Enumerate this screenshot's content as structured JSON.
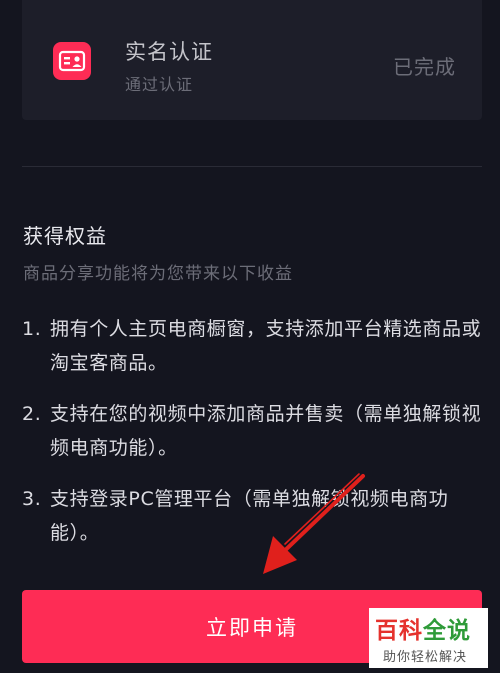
{
  "verification": {
    "title": "实名认证",
    "subtitle": "通过认证",
    "status": "已完成",
    "icon": "id-card-icon",
    "accent_color": "#fe2c55"
  },
  "benefits": {
    "title": "获得权益",
    "subtitle": "商品分享功能将为您带来以下收益",
    "items": [
      {
        "number": "1.",
        "text": "拥有个人主页电商橱窗，支持添加平台精选商品或淘宝客商品。"
      },
      {
        "number": "2.",
        "text": "支持在您的视频中添加商品并售卖（需单独解锁视频电商功能）。"
      },
      {
        "number": "3.",
        "text": "支持登录PC管理平台（需单独解锁视频电商功能）。"
      }
    ]
  },
  "apply_button": {
    "label": "立即申请",
    "color": "#fe2c55"
  },
  "annotation": {
    "icon": "arrow-annotation-icon",
    "color": "#e0201c"
  },
  "watermark": {
    "main_red": "百科",
    "main_green": "全说",
    "sub": "助你轻松解决"
  }
}
